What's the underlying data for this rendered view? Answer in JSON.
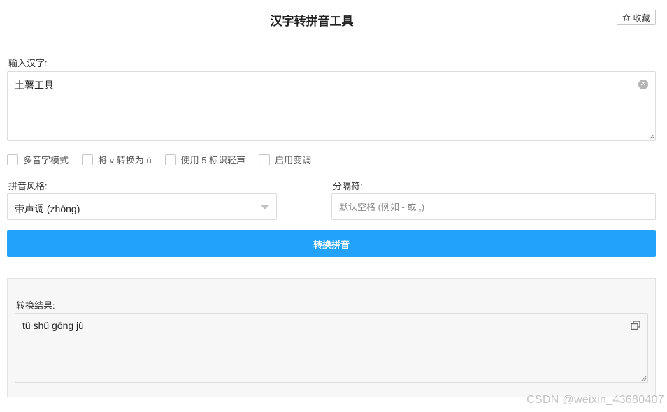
{
  "header": {
    "title": "汉字转拼音工具",
    "favorite_label": "收藏"
  },
  "input": {
    "label": "输入汉字:",
    "value": "土薯工具",
    "clear_icon": "clear-circle-icon"
  },
  "options": [
    {
      "label": "多音字模式",
      "checked": false
    },
    {
      "label": "将 v 转换为 ü",
      "checked": false
    },
    {
      "label": "使用 5 标识轻声",
      "checked": false
    },
    {
      "label": "启用变调",
      "checked": false
    }
  ],
  "style": {
    "label": "拼音风格:",
    "selected": "带声调 (zhōng)"
  },
  "separator": {
    "label": "分隔符:",
    "placeholder": "默认空格 (例如 - 或 ,)",
    "value": ""
  },
  "convert_button": {
    "label": "转换拼音",
    "color": "#23a2fb"
  },
  "result": {
    "label": "转换结果:",
    "value": "tǔ shǔ gōng jù",
    "copy_icon": "copy-icon"
  },
  "watermark": "CSDN @weixin_43680407"
}
